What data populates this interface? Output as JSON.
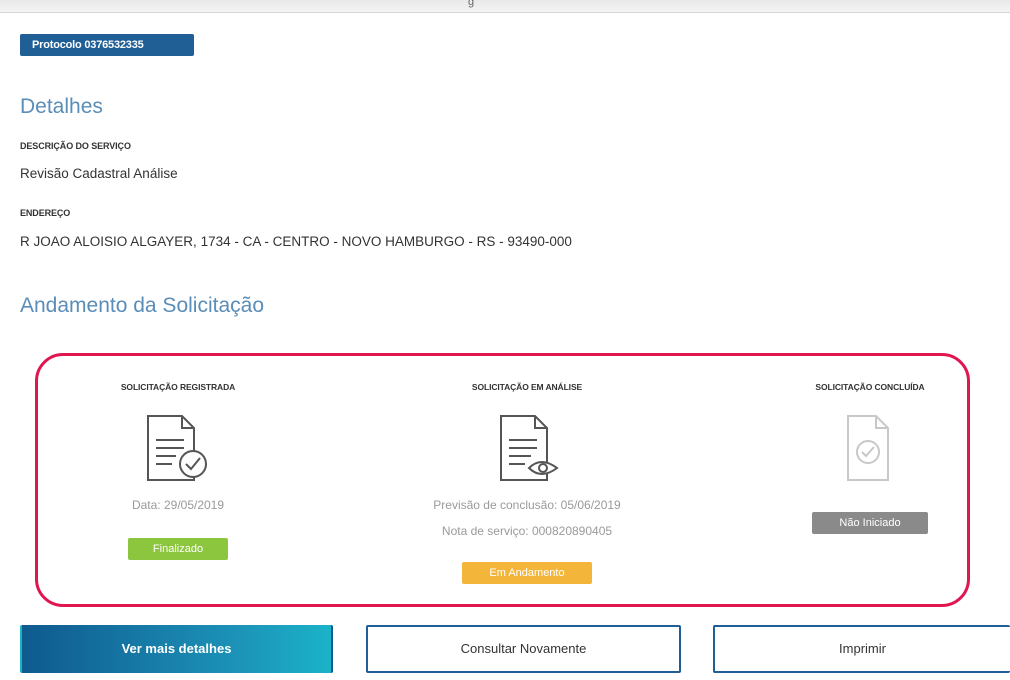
{
  "window_title_fragment": "g",
  "protocol": {
    "label": "Protocolo 0376532335"
  },
  "details": {
    "title": "Detalhes",
    "service_label": "DESCRIÇÃO DO SERVIÇO",
    "service_value": "Revisão Cadastral Análise",
    "address_label": "ENDEREÇO",
    "address_value": "R JOAO ALOISIO ALGAYER, 1734 - CA - CENTRO - NOVO HAMBURGO - RS - 93490-000"
  },
  "progress": {
    "title": "Andamento da Solicitação",
    "steps": [
      {
        "title": "SOLICITAÇÃO REGISTRADA",
        "icon": "document-check-icon",
        "line1": "Data: 29/05/2019",
        "line2": "",
        "status": "Finalizado",
        "status_color": "#8cc63f"
      },
      {
        "title": "SOLICITAÇÃO EM ANÁLISE",
        "icon": "document-eye-icon",
        "line1": "Previsão de conclusão: 05/06/2019",
        "line2": "Nota de serviço: 000820890405",
        "status": "Em Andamento",
        "status_color": "#f4b63a"
      },
      {
        "title": "SOLICITAÇÃO CONCLUÍDA",
        "icon": "document-check-faded-icon",
        "line1": "",
        "line2": "",
        "status": "Não Iniciado",
        "status_color": "#8a8a8a"
      }
    ]
  },
  "actions": {
    "details": "Ver mais detalhes",
    "consult": "Consultar Novamente",
    "print": "Imprimir"
  },
  "colors": {
    "brand": "#1f5f96",
    "highlight_border": "#e0174f",
    "section_title": "#5a8db8"
  }
}
